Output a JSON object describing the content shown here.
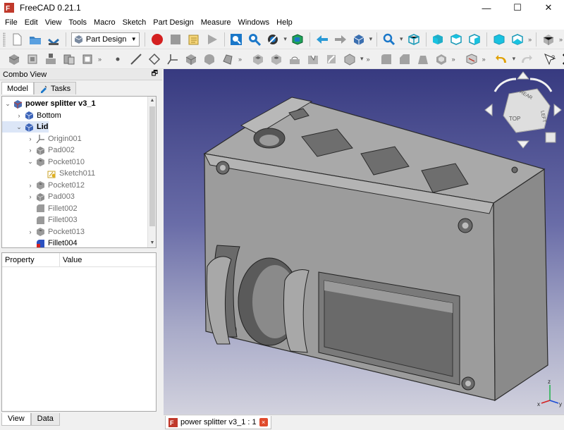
{
  "window": {
    "title": "FreeCAD 0.21.1",
    "minimize": "—",
    "maximize": "☐",
    "close": "✕"
  },
  "menu": [
    "File",
    "Edit",
    "View",
    "Tools",
    "Macro",
    "Sketch",
    "Part Design",
    "Measure",
    "Windows",
    "Help"
  ],
  "toolbar": {
    "workbench": "Part Design",
    "more1": "»",
    "more2": "»",
    "more3": "»",
    "more4": "»",
    "more5": "»",
    "more6": "»"
  },
  "combo": {
    "title": "Combo View",
    "float_icon": "restore-icon",
    "tabs": [
      {
        "label": "Model"
      },
      {
        "label": "Tasks"
      }
    ],
    "tree": [
      {
        "label": "power splitter v3_1",
        "icon": "document-icon",
        "expanded": true,
        "depth": 0,
        "bold": true
      },
      {
        "label": "Bottom",
        "icon": "body-icon",
        "expanded": false,
        "depth": 1
      },
      {
        "label": "Lid",
        "icon": "body-icon",
        "expanded": true,
        "depth": 1,
        "bold": true,
        "selected": true
      },
      {
        "label": "Origin001",
        "icon": "origin-icon",
        "expanded": false,
        "depth": 2,
        "grey": true
      },
      {
        "label": "Pad002",
        "icon": "pad-icon",
        "expanded": false,
        "depth": 2,
        "grey": true
      },
      {
        "label": "Pocket010",
        "icon": "pocket-icon",
        "expanded": true,
        "depth": 2,
        "grey": true
      },
      {
        "label": "Sketch011",
        "icon": "sketch-icon",
        "depth": 3,
        "grey": true
      },
      {
        "label": "Pocket012",
        "icon": "pocket-icon",
        "expanded": false,
        "depth": 2,
        "grey": true
      },
      {
        "label": "Pad003",
        "icon": "pad-icon",
        "expanded": false,
        "depth": 2,
        "grey": true
      },
      {
        "label": "Fillet002",
        "icon": "fillet-icon",
        "depth": 2,
        "grey": true
      },
      {
        "label": "Fillet003",
        "icon": "fillet-icon",
        "depth": 2,
        "grey": true
      },
      {
        "label": "Pocket013",
        "icon": "pocket-icon",
        "expanded": false,
        "depth": 2,
        "grey": true
      },
      {
        "label": "Fillet004",
        "icon": "fillet-tip-icon",
        "depth": 2
      }
    ],
    "props_header": {
      "property": "Property",
      "value": "Value"
    },
    "bottom_tabs": [
      {
        "label": "View"
      },
      {
        "label": "Data"
      }
    ]
  },
  "navcube": {
    "face_top": "TOP",
    "face_rear": "REAR",
    "face_right": "LEFT"
  },
  "axis": {
    "x": "x",
    "y": "y",
    "z": "z"
  },
  "doc_tab": {
    "label": "power splitter v3_1 : 1",
    "close": "×"
  },
  "colors": {
    "accent_blue": "#1a77c9",
    "record_red": "#d42020",
    "model_grey": "#9c9c9c",
    "selection": "#dce6f7",
    "viewport_top": "#373a80",
    "viewport_bottom": "#d2d2de"
  }
}
